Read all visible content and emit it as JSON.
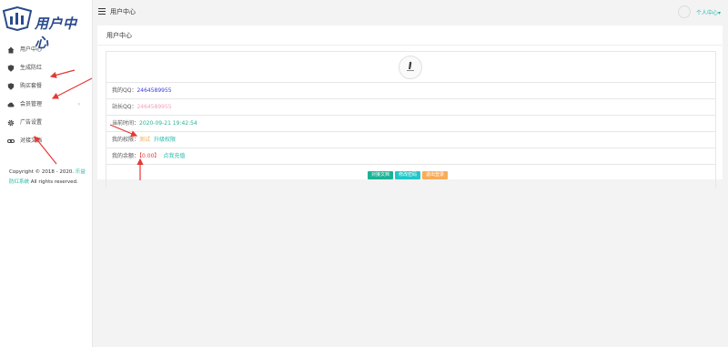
{
  "logo": {
    "text": "用户中心"
  },
  "sidebar": {
    "items": [
      {
        "label": "用户中心",
        "icon": "home-icon"
      },
      {
        "label": "生成防红",
        "icon": "shield-icon"
      },
      {
        "label": "购买套餐",
        "icon": "shield-icon"
      },
      {
        "label": "会员管理",
        "icon": "cloud-icon",
        "arrow": "›"
      },
      {
        "label": "广告设置",
        "icon": "gear-icon"
      },
      {
        "label": "对接文档",
        "icon": "link-icon"
      }
    ],
    "copyright_prefix": "Copyright © 2018 - 2020. ",
    "copyright_brand": "乐益防红系统",
    "copyright_suffix": " All rights reserved."
  },
  "topbar": {
    "title": "用户中心",
    "user_label": "个人中心▾"
  },
  "panel": {
    "title": "用户中心",
    "qq_label": "我的QQ：",
    "qq_value": "2464589955",
    "admin_qq_label": "站长QQ：",
    "admin_qq_value": "2464589955",
    "expire_label": "当前时间：",
    "expire_value": "2020-09-21 19:42:54",
    "perm_label": "我的权限：",
    "perm_value": "测试",
    "perm_link": "升级权限",
    "balance_label": "我的余额：",
    "balance_open": "【",
    "balance_value": "0.00",
    "balance_close": "】",
    "balance_link": "点我充值"
  },
  "buttons": {
    "docs": "对接文档",
    "password": "修改密码",
    "logout": "退出登录"
  },
  "colors": {
    "accent": "#22b8a8",
    "arrow": "#e53935"
  }
}
